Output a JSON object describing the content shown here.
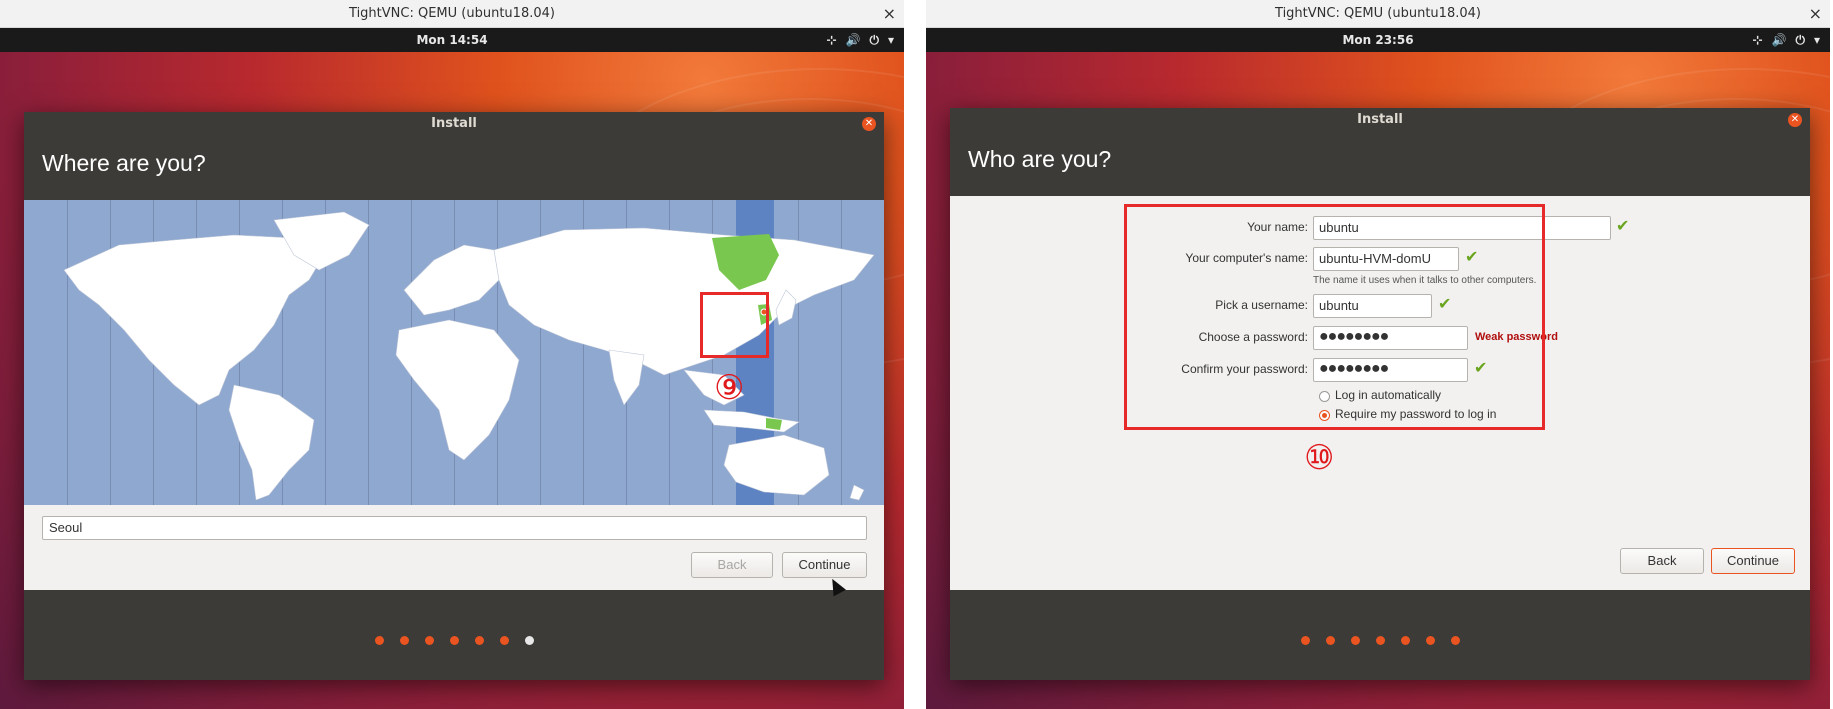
{
  "colors": {
    "accent": "#e95420",
    "highlight": "#e62a2a",
    "header": "#3c3b37",
    "timezone_band": "#5d83c2",
    "selected_country": "#7ac74f",
    "valid_check": "#6aa51f",
    "weak_text": "#b10e0e"
  },
  "step9": {
    "vnc_title": "TightVNC: QEMU (ubuntu18.04)",
    "close_glyph": "×",
    "clock": "Mon 14:54",
    "tray_icons": [
      "network-icon",
      "volume-icon",
      "power-icon",
      "chevron-down-icon"
    ],
    "window_title": "Install",
    "heading": "Where are you?",
    "timezone_value": "Seoul",
    "back_label": "Back",
    "continue_label": "Continue",
    "annotation_label": "⑨",
    "progress": {
      "total": 7,
      "current": 7
    }
  },
  "step10": {
    "vnc_title": "TightVNC: QEMU (ubuntu18.04)",
    "close_glyph": "×",
    "clock": "Mon 23:56",
    "tray_icons": [
      "network-icon",
      "volume-icon",
      "power-icon",
      "chevron-down-icon"
    ],
    "window_title": "Install",
    "heading": "Who are you?",
    "name_label": "Your name:",
    "name_value": "ubuntu",
    "computer_label": "Your computer's name:",
    "computer_value": "ubuntu-HVM-domU",
    "computer_hint": "The name it uses when it talks to other computers.",
    "username_label": "Pick a username:",
    "username_value": "ubuntu",
    "password_label": "Choose a password:",
    "password_value": "●●●●●●●●",
    "password_strength": "Weak password",
    "confirm_label": "Confirm your password:",
    "confirm_value": "●●●●●●●●",
    "login_auto_label": "Log in automatically",
    "login_require_label": "Require my password to log in",
    "login_selected": "require",
    "back_label": "Back",
    "continue_label": "Continue",
    "annotation_label": "⑩",
    "progress": {
      "total": 7,
      "current": 8
    }
  }
}
